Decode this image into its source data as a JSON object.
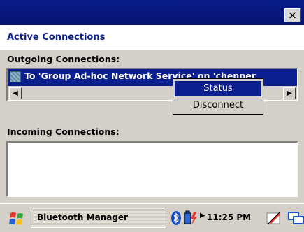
{
  "window": {
    "close_label": "×",
    "title": "Active Connections"
  },
  "outgoing": {
    "label": "Outgoing Connections:",
    "row_text": "To 'Group Ad-hoc Network Service' on 'chenper",
    "scroll_left": "◀",
    "scroll_right": "▶"
  },
  "incoming": {
    "label": "Incoming Connections:"
  },
  "context_menu": {
    "items": [
      "Status",
      "Disconnect"
    ],
    "selected": "Status"
  },
  "taskbar": {
    "app_label": "Bluetooth Manager",
    "tray_arrow": "▶",
    "clock": "11:25 PM"
  },
  "colors": {
    "title_bar": "#0b1f8e",
    "selection": "#0b1f8e",
    "face": "#d4d0c8"
  },
  "icons": [
    "start-flag-icon",
    "bluetooth-icon",
    "ac-power-icon",
    "pen-input-icon",
    "input-panel-icon"
  ]
}
